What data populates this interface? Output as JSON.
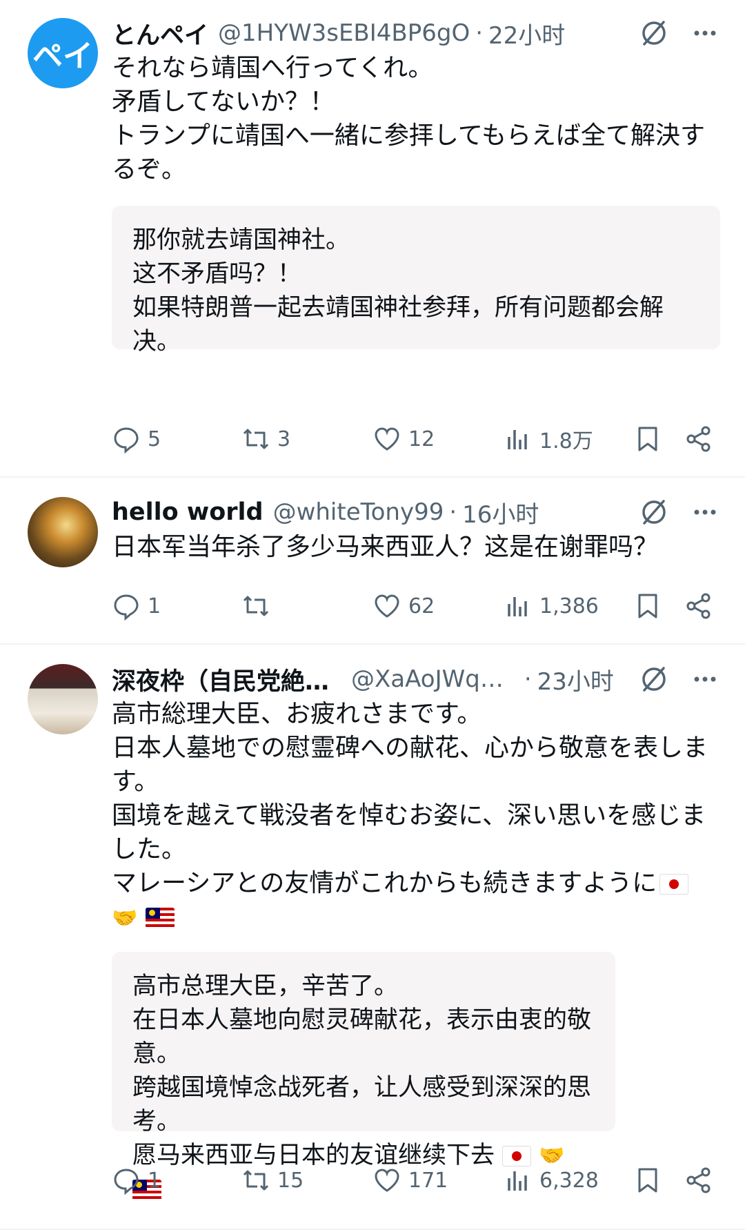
{
  "tweets": [
    {
      "avatar_text": "ペイ",
      "name": "とんペイ",
      "handle": "@1HYW3sEBI4BP6gO",
      "time": "22小时",
      "text": "それなら靖国へ行ってくれ。\n矛盾してないか？！\nトランプに靖国へ一緒に参拝してもらえば全て解決するぞ。",
      "translation": "那你就去靖国神社。\n这不矛盾吗？！\n如果特朗普一起去靖国神社参拜，所有问题都会解决。",
      "replies": "5",
      "retweets": "3",
      "likes": "12",
      "views": "1.8万"
    },
    {
      "name": "hello world",
      "handle": "@whiteTony99",
      "time": "16小时",
      "text": "日本军当年杀了多少马来西亚人？这是在谢罪吗？",
      "replies": "1",
      "retweets": "",
      "likes": "62",
      "views": "1,386"
    },
    {
      "name": "深夜枠（自民党絶…",
      "handle": "@XaAoJWq…",
      "time": "23小时",
      "text": "高市総理大臣、お疲れさまです。\n日本人墓地での慰霊碑への献花、心から敬意を表します。\n国境を越えて戦没者を悼むお姿に、深い思いを感じました。\nマレーシアとの友情がこれからも続きますように",
      "translation": "高市总理大臣，辛苦了。\n在日本人墓地向慰灵碑献花，表示由衷的敬意。\n跨越国境悼念战死者，让人感受到深深的思考。\n愿马来西亚与日本的友谊继续下去",
      "replies": "1",
      "retweets": "15",
      "likes": "171",
      "views": "6,328"
    }
  ],
  "icons": {
    "reply": "reply-icon",
    "retweet": "retweet-icon",
    "like": "heart-icon",
    "views": "views-icon",
    "bookmark": "bookmark-icon",
    "share": "share-icon",
    "grok": "grok-icon",
    "more": "more-icon"
  },
  "colors": {
    "accent": "#1d9bf0",
    "muted": "#536471",
    "translation_bg": "#f7f4f5"
  }
}
